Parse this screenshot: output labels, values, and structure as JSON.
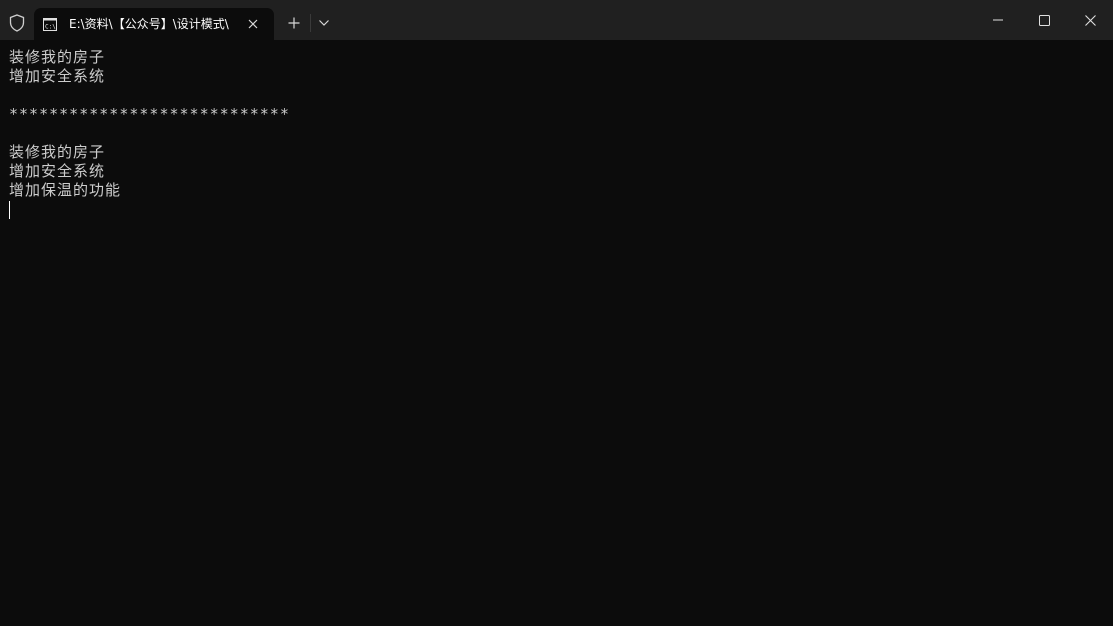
{
  "window": {
    "tab_title": "E:\\资料\\【公众号】\\设计模式\\",
    "tab_icon": "terminal-icon",
    "left_icon": "shield-icon",
    "new_tab_icon": "plus-icon",
    "dropdown_icon": "chevron-down-icon",
    "controls": [
      "minimize-icon",
      "maximize-icon",
      "close-icon"
    ]
  },
  "console": {
    "lines": [
      "装修我的房子",
      "增加安全系统",
      "",
      "****************************",
      "",
      "装修我的房子",
      "增加安全系统",
      "增加保温的功能"
    ]
  },
  "colors": {
    "background": "#0c0c0c",
    "titlebar": "#202020",
    "text": "#cccccc",
    "cursor": "#ffffff"
  }
}
